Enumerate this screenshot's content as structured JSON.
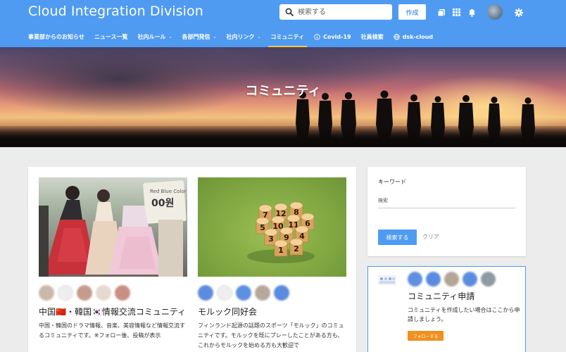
{
  "header": {
    "site_title": "Cloud Integration Division",
    "search_placeholder": "検索する",
    "create_label": "作成",
    "icons": [
      "search-icon",
      "pages-icon",
      "apps-grid-icon",
      "notifications-icon",
      "settings-icon"
    ]
  },
  "nav": {
    "items": [
      {
        "label": "事業部からのお知らせ"
      },
      {
        "label": "ニュース一覧"
      },
      {
        "label": "社内ルール",
        "chevron": "⌄"
      },
      {
        "label": "各部門発信",
        "chevron": "⌄"
      },
      {
        "label": "社内リンク",
        "chevron": "⌄"
      },
      {
        "label": "コミュニティ",
        "active": true
      },
      {
        "label": "Covid-19",
        "icon": "info-icon"
      },
      {
        "label": "社員検索"
      },
      {
        "label": "dsk-cloud",
        "icon": "globe-icon"
      }
    ]
  },
  "hero": {
    "title": "コミュニティ"
  },
  "communities": [
    {
      "title": "中国🇨🇳・韓国🇰🇷情報交流コミュニティ",
      "description": "中国・韓国のドラマ情報、音楽、美容情報など情報交流するコミュニティです。※フォロー後、投稿が表示",
      "photo_sign_text": "Red Blue Color",
      "photo_sign_number": "00원"
    },
    {
      "title": "モルック同好会",
      "description": "フィンランド起源の話題のスポーツ「モルック」のコミュニティです。モルックを既にプレーしたことがある方も、これからモルックを始める方も大歓迎で",
      "pin_numbers": [
        "7",
        "12",
        "8",
        "5",
        "10",
        "11",
        "6",
        "3",
        "9",
        "4",
        "1",
        "2"
      ]
    }
  ],
  "sidebar": {
    "search": {
      "label": "キーワード",
      "placeholder": "検索",
      "search_button": "検索する",
      "clear_button": "クリア"
    },
    "apply": {
      "title": "コミュニティ申請",
      "description": "コミュニティを作成したい場合はここから申請しましょう。",
      "follow_button": "フォローする"
    }
  },
  "colors": {
    "header_bg": "#4f9bf2",
    "active_underline": "#f6c54c",
    "follow_button": "#f0901e"
  }
}
